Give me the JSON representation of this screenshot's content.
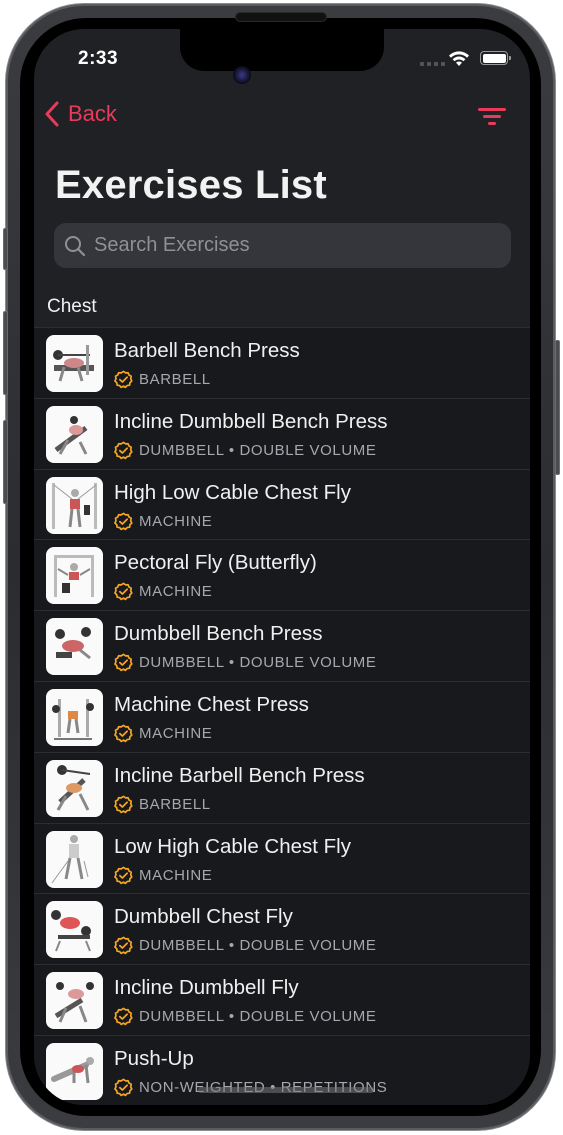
{
  "status_bar": {
    "time": "2:33"
  },
  "nav": {
    "back_label": "Back",
    "filter_icon": "filter-icon"
  },
  "header": {
    "title": "Exercises List"
  },
  "search": {
    "placeholder": "Search Exercises",
    "value": ""
  },
  "section": {
    "title": "Chest"
  },
  "colors": {
    "accent": "#ea3a5a",
    "badge": "#f5a623",
    "background": "#1f2124",
    "list_background": "#18191c"
  },
  "exercises": [
    {
      "name": "Barbell Bench Press",
      "tags": "BARBELL"
    },
    {
      "name": "Incline Dumbbell Bench Press",
      "tags": "DUMBBELL • DOUBLE VOLUME"
    },
    {
      "name": "High Low Cable Chest Fly",
      "tags": "MACHINE"
    },
    {
      "name": "Pectoral Fly (Butterfly)",
      "tags": "MACHINE"
    },
    {
      "name": "Dumbbell Bench Press",
      "tags": "DUMBBELL • DOUBLE VOLUME"
    },
    {
      "name": "Machine Chest Press",
      "tags": "MACHINE"
    },
    {
      "name": "Incline Barbell Bench Press",
      "tags": "BARBELL"
    },
    {
      "name": "Low High Cable Chest Fly",
      "tags": "MACHINE"
    },
    {
      "name": "Dumbbell Chest Fly",
      "tags": "DUMBBELL • DOUBLE VOLUME"
    },
    {
      "name": "Incline Dumbbell Fly",
      "tags": "DUMBBELL • DOUBLE VOLUME"
    },
    {
      "name": "Push-Up",
      "tags": "NON-WEIGHTED • REPETITIONS"
    }
  ]
}
